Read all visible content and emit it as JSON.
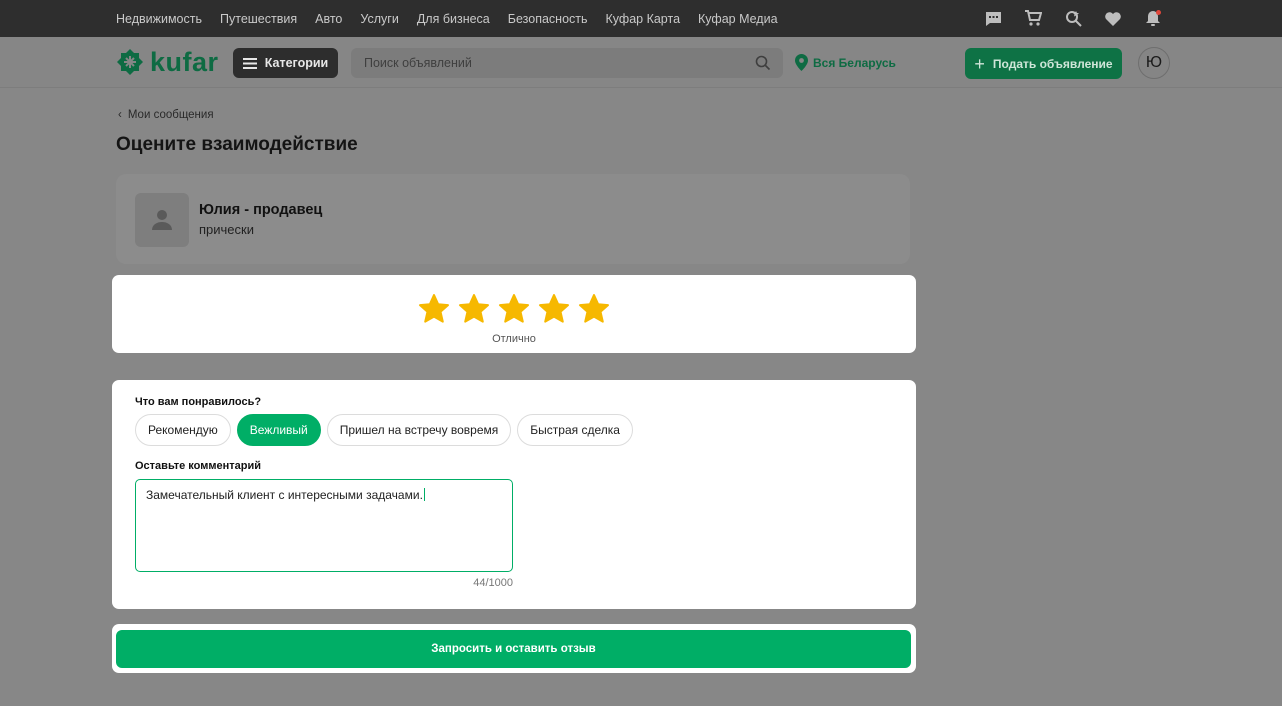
{
  "top_nav": {
    "links": [
      "Недвижимость",
      "Путешествия",
      "Авто",
      "Услуги",
      "Для бизнеса",
      "Безопасность",
      "Куфар Карта",
      "Куфар Медиа"
    ],
    "icons": [
      "chat-icon",
      "cart-icon",
      "saved-search-icon",
      "heart-icon",
      "bell-icon"
    ]
  },
  "header": {
    "logo_text": "kufar",
    "categories_label": "Категории",
    "search_placeholder": "Поиск объявлений",
    "location_label": "Вся Беларусь",
    "post_ad_label": "Подать объявление",
    "avatar_letter": "Ю"
  },
  "breadcrumb": {
    "back_label": "Мои сообщения"
  },
  "page_title": "Оцените взаимодействие",
  "seller": {
    "name": "Юлия - продавец",
    "subtitle": "прически"
  },
  "rating": {
    "stars": 5,
    "max": 5,
    "label": "Отлично"
  },
  "form": {
    "liked_question": "Что вам понравилось?",
    "chips": [
      {
        "label": "Рекомендую",
        "selected": false
      },
      {
        "label": "Вежливый",
        "selected": true
      },
      {
        "label": "Пришел на встречу вовремя",
        "selected": false
      },
      {
        "label": "Быстрая сделка",
        "selected": false
      }
    ],
    "comment_label": "Оставьте комментарий",
    "comment_value": "Замечательный клиент с интересными задачами.",
    "counter": "44/1000"
  },
  "submit_label": "Запросить и оставить отзыв",
  "colors": {
    "accent": "#00ae66",
    "star": "#f6b800",
    "overlay": "#878787"
  }
}
